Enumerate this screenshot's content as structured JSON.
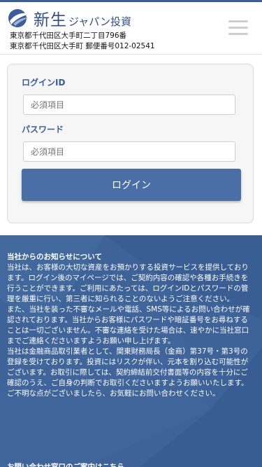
{
  "brand": {
    "name": "新生",
    "sub": "ジャパン投資"
  },
  "address": {
    "line1": "東京都千代田区大手町二丁目796番",
    "line2": "東京都千代田区大手町 郵便番号012-02541"
  },
  "login": {
    "id_label": "ログインID",
    "id_placeholder": "必須項目",
    "pw_label": "パスワード",
    "pw_placeholder": "必須項目",
    "submit_label": "ログイン"
  },
  "info": {
    "title": "当社からのお知らせについて",
    "para1": "当社は、お客様の大切な資産をお預かりする投資サービスを提供しております。ログイン後のマイページでは、ご契約内容の確認や各種お手続きを行うことができます。ご利用にあたっては、ログインIDとパスワードの管理を厳重に行い、第三者に知られることのないようご注意ください。",
    "para2": "また、当社を装った不審なメールや電話、SMS等によるお問い合わせが確認されております。当社からお客様にパスワードや暗証番号をお尋ねすることは一切ございません。不審な連絡を受けた場合は、速やかに当社窓口までご連絡くださいますようお願い申し上げます。",
    "para3": "当社は金融商品取引業者として、関東財務局長（金商）第37号・第3号の登録を受けております。投資にはリスクが伴い、元本を割り込む可能性がございます。お取引に際しては、契約締結前交付書面等の内容を十分にご確認のうえ、ご自身の判断でお取引くださいますようお願いいたします。ご不明な点がございましたら、お気軽にお問い合わせください。",
    "footer": "お問い合わせ窓口のご案内はこちら"
  }
}
